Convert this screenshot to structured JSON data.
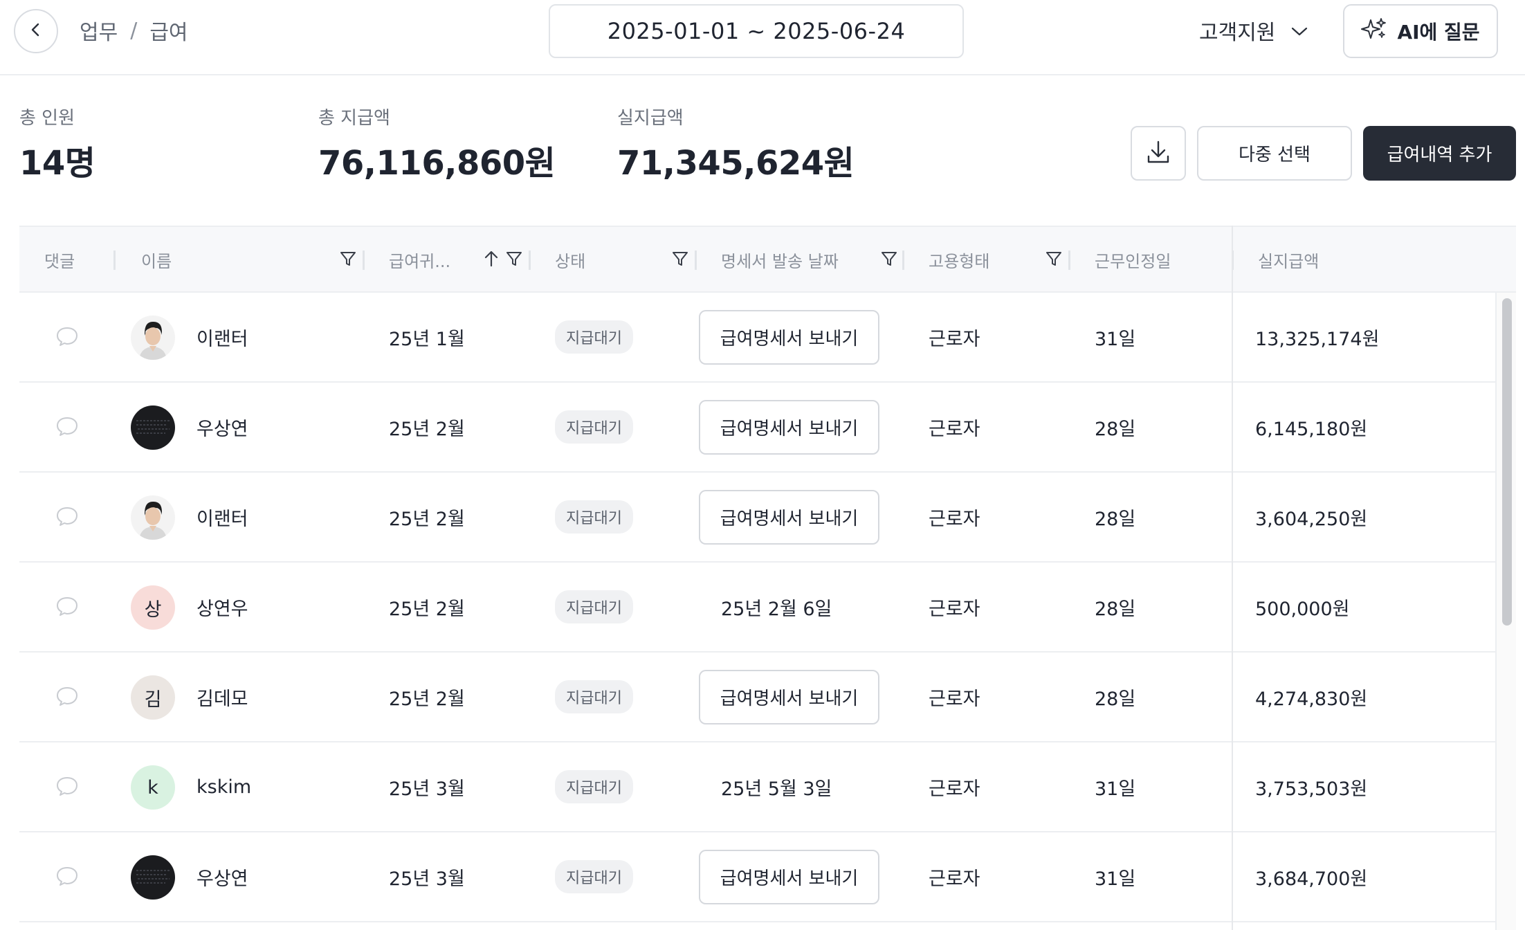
{
  "header": {
    "back_icon": "chevron-left-icon",
    "breadcrumb": [
      "업무",
      "급여"
    ],
    "breadcrumb_sep": "/",
    "date_range": "2025-01-01 ~ 2025-06-24",
    "support_label": "고객지원",
    "support_icon": "chevron-down-icon",
    "ai_label": "AI에 질문",
    "ai_icon": "sparkle-icon"
  },
  "summary": {
    "total_staff_label": "총 인원",
    "total_staff_value": "14명",
    "total_pay_label": "총 지급액",
    "total_pay_value": "76,116,860원",
    "net_pay_label": "실지급액",
    "net_pay_value": "71,345,624원"
  },
  "actions": {
    "download_icon": "download-icon",
    "multi_select_label": "다중 선택",
    "add_label": "급여내역 추가"
  },
  "table": {
    "columns": [
      "댓글",
      "이름",
      "급여귀...",
      "상태",
      "명세서 발송 날짜",
      "고용형태",
      "근무인정일",
      "실지급액"
    ],
    "rows": [
      {
        "name": "이랜터",
        "avatar": "photo",
        "period": "25년 1월",
        "status": "지급대기",
        "sent": "",
        "send_label": "급여명세서 보내기",
        "type": "근로자",
        "days": "31일",
        "net": "13,325,174원"
      },
      {
        "name": "우상연",
        "avatar": "dark",
        "period": "25년 2월",
        "status": "지급대기",
        "sent": "",
        "send_label": "급여명세서 보내기",
        "type": "근로자",
        "days": "28일",
        "net": "6,145,180원"
      },
      {
        "name": "이랜터",
        "avatar": "photo",
        "period": "25년 2월",
        "status": "지급대기",
        "sent": "",
        "send_label": "급여명세서 보내기",
        "type": "근로자",
        "days": "28일",
        "net": "3,604,250원"
      },
      {
        "name": "상연우",
        "avatar": "initial",
        "initial": "상",
        "avatar_bg": "#f8dcd9",
        "period": "25년 2월",
        "status": "지급대기",
        "sent": "25년 2월 6일",
        "send_label": "",
        "type": "근로자",
        "days": "28일",
        "net": "500,000원"
      },
      {
        "name": "김데모",
        "avatar": "initial",
        "initial": "김",
        "avatar_bg": "#ebe6e2",
        "period": "25년 2월",
        "status": "지급대기",
        "sent": "",
        "send_label": "급여명세서 보내기",
        "type": "근로자",
        "days": "28일",
        "net": "4,274,830원"
      },
      {
        "name": "kskim",
        "avatar": "initial",
        "initial": "k",
        "avatar_bg": "#d9f2e1",
        "period": "25년 3월",
        "status": "지급대기",
        "sent": "25년 5월 3일",
        "send_label": "",
        "type": "근로자",
        "days": "31일",
        "net": "3,753,503원"
      },
      {
        "name": "우상연",
        "avatar": "dark",
        "period": "25년 3월",
        "status": "지급대기",
        "sent": "",
        "send_label": "급여명세서 보내기",
        "type": "근로자",
        "days": "31일",
        "net": "3,684,700원"
      }
    ]
  },
  "colors": {
    "primary_button": "#272c36",
    "border": "#d9dce1",
    "header_bg": "#f7f8fa"
  }
}
